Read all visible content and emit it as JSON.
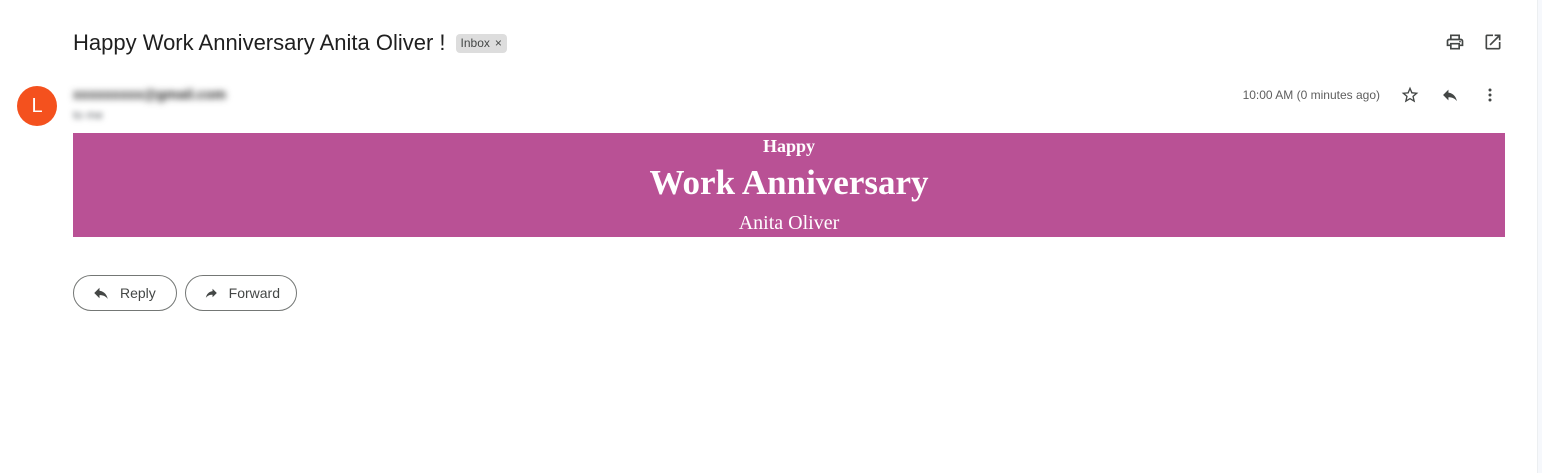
{
  "email": {
    "subject": "Happy Work Anniversary Anita Oliver !",
    "label": "Inbox",
    "label_close": "×",
    "avatar_letter": "L",
    "avatar_color": "#f4511e",
    "sender_email": "xxxxxxxxx@gmail.com",
    "recipient": "to me",
    "timestamp": "10:00 AM (0 minutes ago)"
  },
  "banner": {
    "line1": "Happy",
    "line2": "Work Anniversary",
    "line3": "Anita Oliver",
    "background": "#b95195"
  },
  "actions": {
    "reply_label": "Reply",
    "forward_label": "Forward"
  },
  "icons": {
    "print": "print-icon",
    "open_new_window": "open-in-new-icon",
    "star": "star-icon",
    "reply": "reply-icon",
    "more": "more-vert-icon",
    "forward": "forward-icon"
  }
}
